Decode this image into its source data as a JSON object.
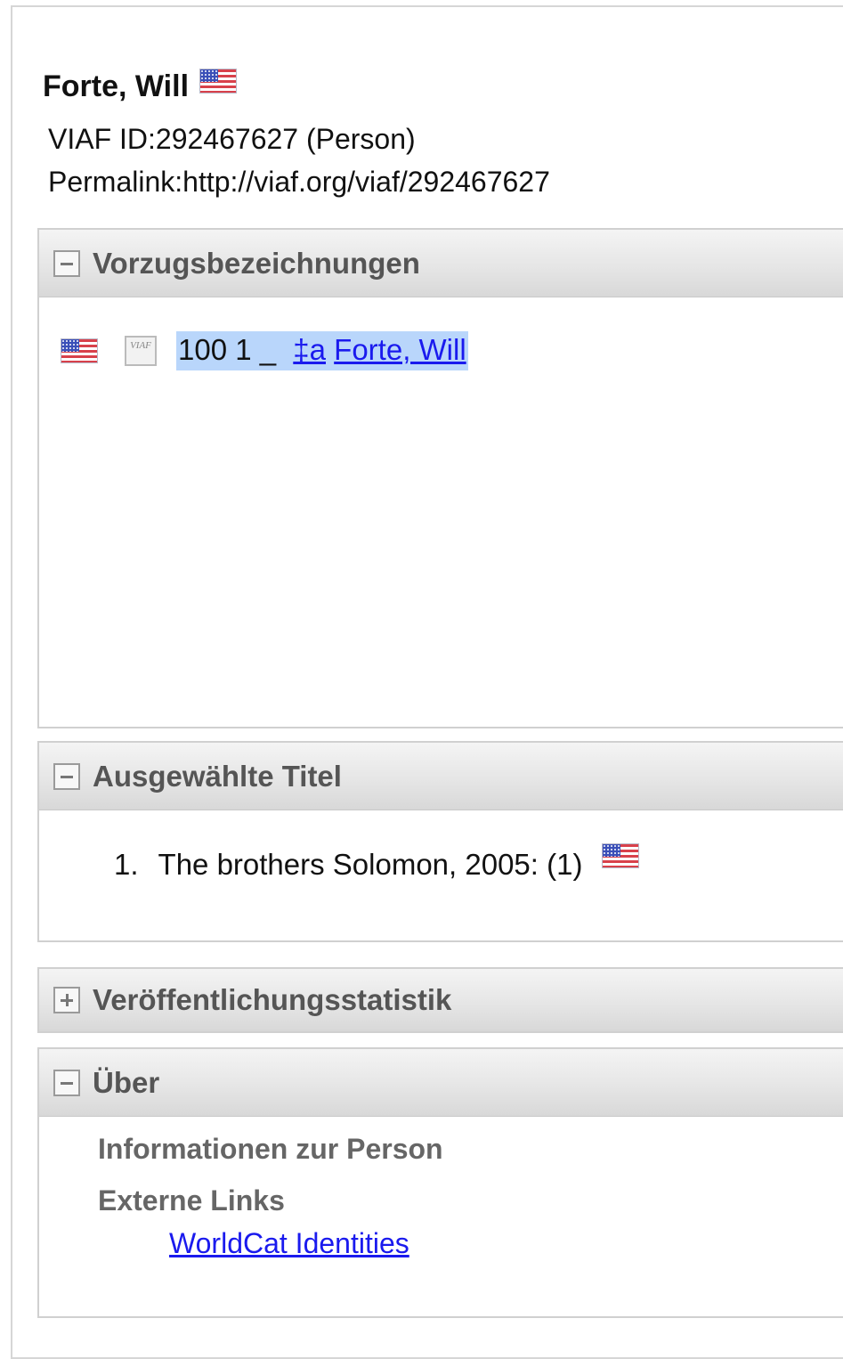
{
  "record": {
    "name": "Forte, Will",
    "viaf_id": "VIAF ID:292467627 (Person)",
    "permalink": "Permalink:http://viaf.org/viaf/292467627",
    "flag_icon": "us-flag-icon"
  },
  "sections": {
    "preferred": {
      "title": "Vorzugsbezeichnungen",
      "toggle": "collapse",
      "heading": {
        "tag": "100 1 _",
        "subfield": "‡a",
        "value": "Forte, Will",
        "viaf_icon_text": "VIAF"
      }
    },
    "titles": {
      "title": "Ausgewählte Titel",
      "toggle": "collapse",
      "items": [
        {
          "number": "1.",
          "text": "The brothers Solomon, 2005: (1)"
        }
      ]
    },
    "stats": {
      "title": "Veröffentlichungsstatistik",
      "toggle": "expand"
    },
    "about": {
      "title": "Über",
      "toggle": "collapse",
      "info_label": "Informationen zur Person",
      "external_label": "Externe Links",
      "worldcat_link": "WorldCat Identities"
    }
  },
  "colors": {
    "link": "#1a1aee",
    "highlight": "#b9d6fb",
    "header_text": "#555555"
  }
}
